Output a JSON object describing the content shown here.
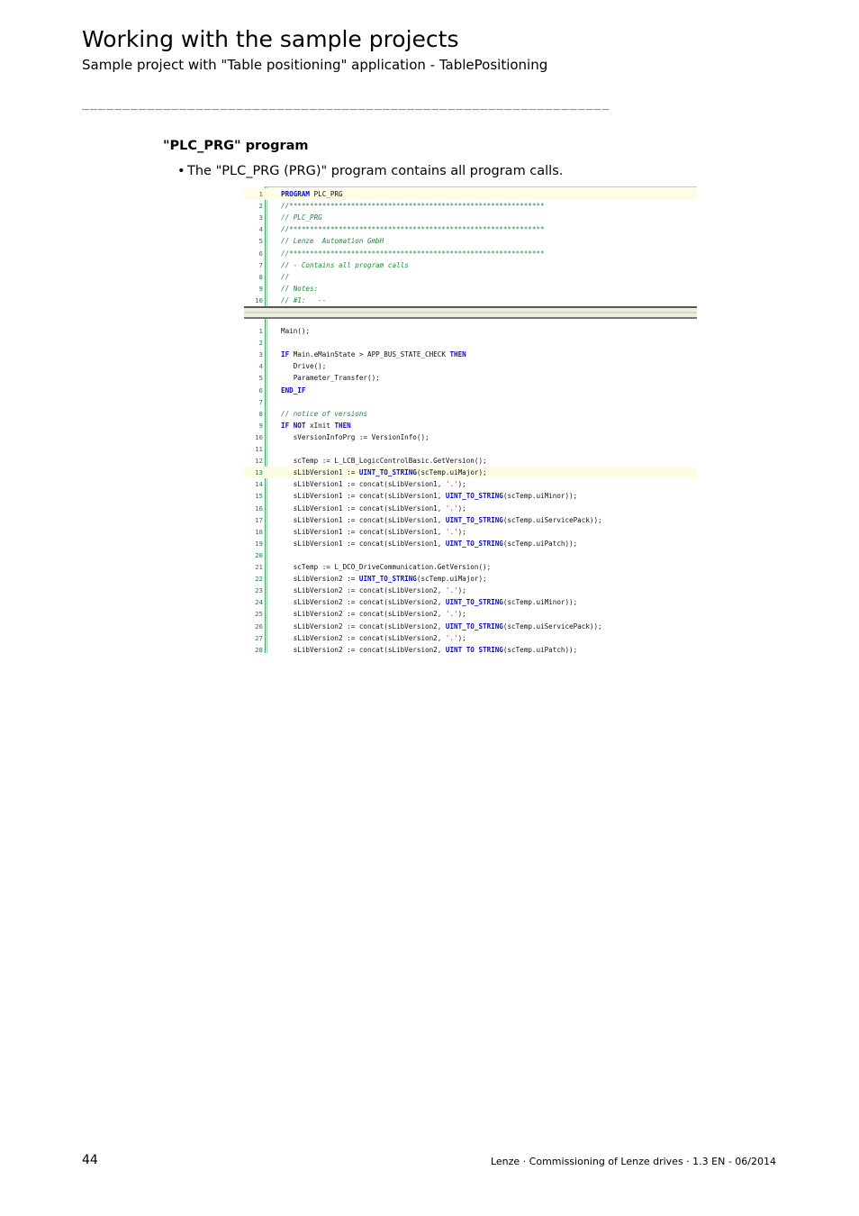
{
  "header": {
    "title": "Working with the sample projects",
    "subtitle": "Sample project with \"Table positioning\" application - TablePositioning",
    "separator": "_________________________________________________________________"
  },
  "section": {
    "heading": "\"PLC_PRG\" program",
    "bullet_marker": "•",
    "bullet_text": "The \"PLC_PRG (PRG)\" program contains all program calls."
  },
  "code": {
    "declaration": [
      {
        "n": "1",
        "hl": true,
        "tokens": [
          [
            "k",
            "PROGRAM"
          ],
          [
            "t",
            " PLC_PRG"
          ]
        ]
      },
      {
        "n": "2",
        "tokens": [
          [
            "c",
            "//**************************************************************"
          ]
        ]
      },
      {
        "n": "3",
        "tokens": [
          [
            "c",
            "// PLC_PRG"
          ]
        ]
      },
      {
        "n": "4",
        "tokens": [
          [
            "c",
            "//**************************************************************"
          ]
        ]
      },
      {
        "n": "5",
        "tokens": [
          [
            "c",
            "// Lenze  Automation GmbH"
          ]
        ]
      },
      {
        "n": "6",
        "tokens": [
          [
            "c",
            "//**************************************************************"
          ]
        ]
      },
      {
        "n": "7",
        "tokens": [
          [
            "c",
            "// - Contains all program calls"
          ]
        ]
      },
      {
        "n": "8",
        "tokens": [
          [
            "c",
            "//"
          ]
        ]
      },
      {
        "n": "9",
        "tokens": [
          [
            "c",
            "// Notes:"
          ]
        ]
      },
      {
        "n": "10",
        "tokens": [
          [
            "c",
            "// #1:   --"
          ]
        ]
      }
    ],
    "implementation": [
      {
        "n": "1",
        "tokens": [
          [
            "t",
            "Main();"
          ]
        ]
      },
      {
        "n": "2",
        "tokens": []
      },
      {
        "n": "3",
        "tokens": [
          [
            "k",
            "IF"
          ],
          [
            "t",
            " Main.eMainState > APP_BUS_STATE_CHECK "
          ],
          [
            "k",
            "THEN"
          ]
        ]
      },
      {
        "n": "4",
        "tokens": [
          [
            "t",
            "   Drive();"
          ]
        ]
      },
      {
        "n": "5",
        "tokens": [
          [
            "t",
            "   Parameter_Transfer();"
          ]
        ]
      },
      {
        "n": "6",
        "tokens": [
          [
            "k",
            "END_IF"
          ]
        ]
      },
      {
        "n": "7",
        "tokens": []
      },
      {
        "n": "8",
        "tokens": [
          [
            "c",
            "// notice of versions"
          ]
        ]
      },
      {
        "n": "9",
        "tokens": [
          [
            "k",
            "IF NOT"
          ],
          [
            "t",
            " xInit "
          ],
          [
            "k",
            "THEN"
          ]
        ]
      },
      {
        "n": "10",
        "tokens": [
          [
            "t",
            "   sVersionInfoPrg := VersionInfo();"
          ]
        ]
      },
      {
        "n": "11",
        "tokens": []
      },
      {
        "n": "12",
        "tokens": [
          [
            "t",
            "   scTemp := L_LCB_LogicControlBasic.GetVersion();"
          ]
        ]
      },
      {
        "n": "13",
        "hl": true,
        "tokens": [
          [
            "t",
            "   sLibVersion1 := "
          ],
          [
            "k",
            "UINT_TO_STRING"
          ],
          [
            "t",
            "(scTemp.uiMajor);"
          ]
        ]
      },
      {
        "n": "14",
        "tokens": [
          [
            "t",
            "   sLibVersion1 := concat(sLibVersion1, "
          ],
          [
            "s",
            "'.'"
          ],
          [
            "t",
            ");"
          ]
        ]
      },
      {
        "n": "15",
        "tokens": [
          [
            "t",
            "   sLibVersion1 := concat(sLibVersion1, "
          ],
          [
            "k",
            "UINT_TO_STRING"
          ],
          [
            "t",
            "(scTemp.uiMinor));"
          ]
        ]
      },
      {
        "n": "16",
        "tokens": [
          [
            "t",
            "   sLibVersion1 := concat(sLibVersion1, "
          ],
          [
            "s",
            "'.'"
          ],
          [
            "t",
            ");"
          ]
        ]
      },
      {
        "n": "17",
        "tokens": [
          [
            "t",
            "   sLibVersion1 := concat(sLibVersion1, "
          ],
          [
            "k",
            "UINT_TO_STRING"
          ],
          [
            "t",
            "(scTemp.uiServicePack));"
          ]
        ]
      },
      {
        "n": "18",
        "tokens": [
          [
            "t",
            "   sLibVersion1 := concat(sLibVersion1, "
          ],
          [
            "s",
            "'.'"
          ],
          [
            "t",
            ");"
          ]
        ]
      },
      {
        "n": "19",
        "tokens": [
          [
            "t",
            "   sLibVersion1 := concat(sLibVersion1, "
          ],
          [
            "k",
            "UINT_TO_STRING"
          ],
          [
            "t",
            "(scTemp.uiPatch));"
          ]
        ]
      },
      {
        "n": "20",
        "tokens": []
      },
      {
        "n": "21",
        "tokens": [
          [
            "t",
            "   scTemp := L_DCO_DriveCommunication.GetVersion();"
          ]
        ]
      },
      {
        "n": "22",
        "tokens": [
          [
            "t",
            "   sLibVersion2 := "
          ],
          [
            "k",
            "UINT_TO_STRING"
          ],
          [
            "t",
            "(scTemp.uiMajor);"
          ]
        ]
      },
      {
        "n": "23",
        "tokens": [
          [
            "t",
            "   sLibVersion2 := concat(sLibVersion2, "
          ],
          [
            "s",
            "'.'"
          ],
          [
            "t",
            ");"
          ]
        ]
      },
      {
        "n": "24",
        "tokens": [
          [
            "t",
            "   sLibVersion2 := concat(sLibVersion2, "
          ],
          [
            "k",
            "UINT_TO_STRING"
          ],
          [
            "t",
            "(scTemp.uiMinor));"
          ]
        ]
      },
      {
        "n": "25",
        "tokens": [
          [
            "t",
            "   sLibVersion2 := concat(sLibVersion2, "
          ],
          [
            "s",
            "'.'"
          ],
          [
            "t",
            ");"
          ]
        ]
      },
      {
        "n": "26",
        "tokens": [
          [
            "t",
            "   sLibVersion2 := concat(sLibVersion2, "
          ],
          [
            "k",
            "UINT_TO_STRING"
          ],
          [
            "t",
            "(scTemp.uiServicePack));"
          ]
        ]
      },
      {
        "n": "27",
        "tokens": [
          [
            "t",
            "   sLibVersion2 := concat(sLibVersion2, "
          ],
          [
            "s",
            "'.'"
          ],
          [
            "t",
            ");"
          ]
        ]
      },
      {
        "n": "28",
        "tokens": [
          [
            "t",
            "   sLibVersion2 := concat(sLibVersion2, "
          ],
          [
            "k",
            "UINT_TO_STRING"
          ],
          [
            "t",
            "(scTemp.uiPatch));"
          ]
        ]
      }
    ]
  },
  "footer": {
    "page_number": "44",
    "text": "Lenze · Commissioning of Lenze drives · 1.3 EN - 06/2014"
  },
  "colors": {
    "keyword": "#0b0bd0",
    "comment": "#1d8a3a",
    "string": "#b02020",
    "line_number": "#2f7a4a",
    "highlight_line": "#fdfce4"
  }
}
